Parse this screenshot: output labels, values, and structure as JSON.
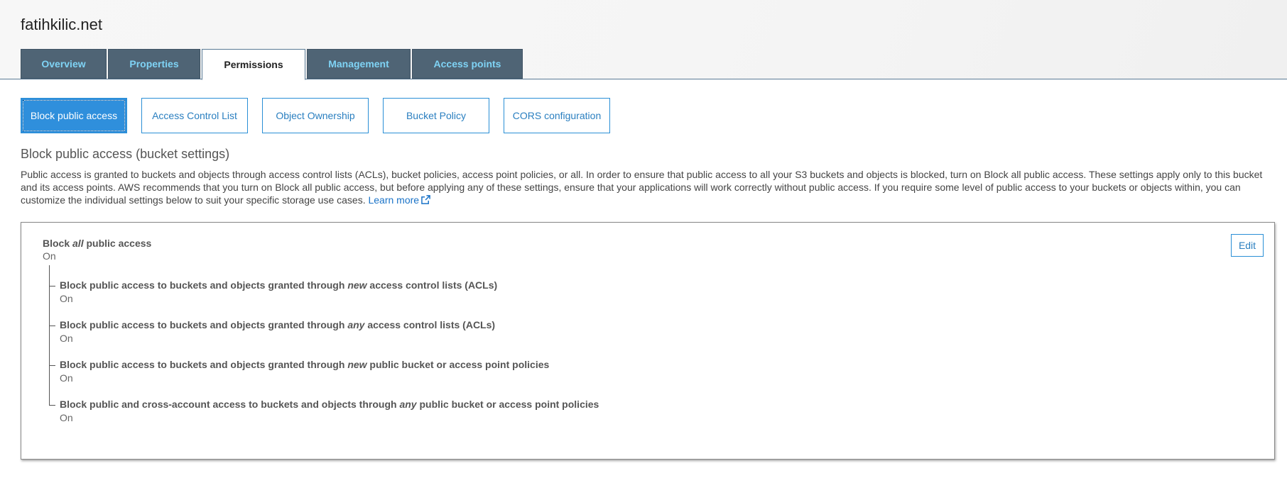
{
  "bucket": {
    "name": "fatihkilic.net"
  },
  "tabs": [
    {
      "label": "Overview"
    },
    {
      "label": "Properties"
    },
    {
      "label": "Permissions"
    },
    {
      "label": "Management"
    },
    {
      "label": "Access points"
    }
  ],
  "active_tab": "Permissions",
  "subtabs": [
    {
      "label": "Block public access"
    },
    {
      "label": "Access Control List"
    },
    {
      "label": "Object Ownership"
    },
    {
      "label": "Bucket Policy"
    },
    {
      "label": "CORS configuration"
    }
  ],
  "active_subtab": "Block public access",
  "section": {
    "title": "Block public access (bucket settings)",
    "description": "Public access is granted to buckets and objects through access control lists (ACLs), bucket policies, access point policies, or all. In order to ensure that public access to all your S3 buckets and objects is blocked, turn on Block all public access. These settings apply only to this bucket and its access points. AWS recommends that you turn on Block all public access, but before applying any of these settings, ensure that your applications will work correctly without public access. If you require some level of public access to your buckets or objects within, you can customize the individual settings below to suit your specific storage use cases.",
    "learn_more": "Learn more"
  },
  "panel": {
    "edit_label": "Edit",
    "main": {
      "label_pre": "Block ",
      "label_em": "all",
      "label_post": " public access",
      "value": "On"
    },
    "items": [
      {
        "label_pre": "Block public access to buckets and objects granted through ",
        "label_em": "new",
        "label_post": " access control lists (ACLs)",
        "value": "On"
      },
      {
        "label_pre": "Block public access to buckets and objects granted through ",
        "label_em": "any",
        "label_post": " access control lists (ACLs)",
        "value": "On"
      },
      {
        "label_pre": "Block public access to buckets and objects granted through ",
        "label_em": "new",
        "label_post": " public bucket or access point policies",
        "value": "On"
      },
      {
        "label_pre": "Block public and cross-account access to buckets and objects through ",
        "label_em": "any",
        "label_post": " public bucket or access point policies",
        "value": "On"
      }
    ]
  },
  "colors": {
    "tab_bg": "#4f6475",
    "tab_text": "#7fd3f5",
    "accent": "#2f8fdc",
    "link": "#1a73c8"
  }
}
